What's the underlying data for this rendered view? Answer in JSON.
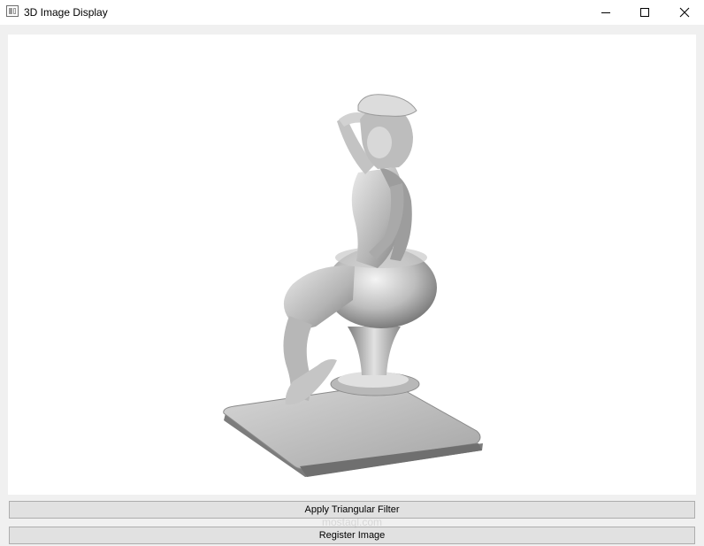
{
  "window": {
    "title": "3D Image Display",
    "icon": "app-window-icon",
    "controls": [
      "minimize-icon",
      "maximize-icon",
      "close-icon"
    ]
  },
  "viewport": {
    "content": "3D-rendered figurine of a woman in a cap seated on a pedestal stool atop a square base"
  },
  "buttons": {
    "apply_filter": "Apply Triangular Filter",
    "register_image": "Register Image"
  },
  "watermark": {
    "text": "mostaql.com"
  },
  "colors": {
    "window_bg": "#f0f0f0",
    "titlebar_bg": "#ffffff",
    "viewport_bg": "#ffffff",
    "button_bg": "#e1e1e1",
    "button_border": "#adadad",
    "model_gray": "#9c9c9c"
  }
}
